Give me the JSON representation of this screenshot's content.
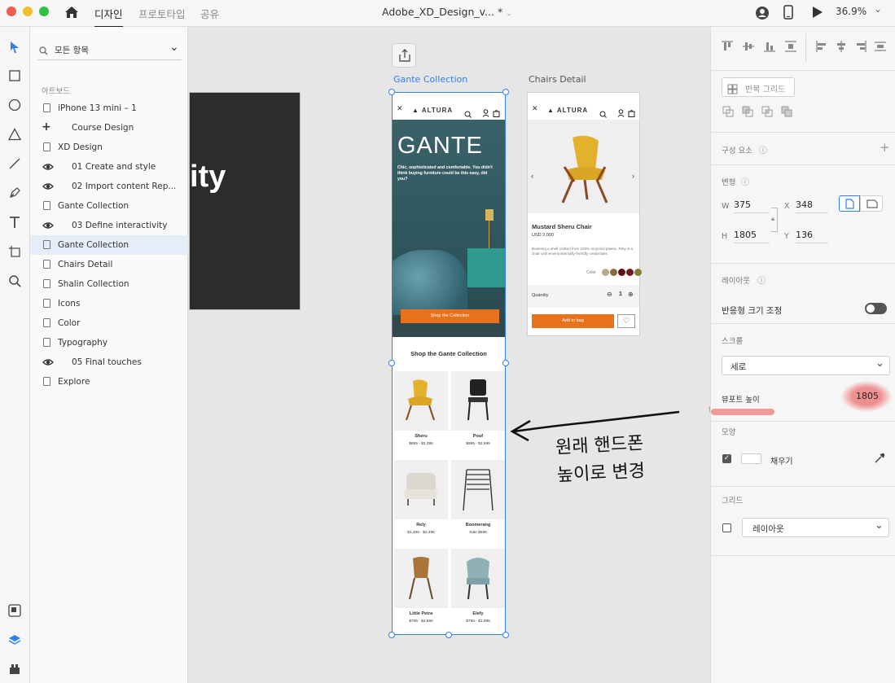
{
  "window": {
    "title": "Adobe_XD_Design_v...",
    "modified_marker": "*",
    "zoom": "36.9%",
    "tabs": [
      "디자인",
      "프로토타입",
      "공유"
    ]
  },
  "layers": {
    "search_placeholder": "모든 항목",
    "section_title": "아트보드",
    "items": [
      {
        "label": "iPhone 13 mini – 1",
        "icon": "doc-icon"
      },
      {
        "label": "Course Design",
        "icon": "plus-icon"
      },
      {
        "label": "XD Design",
        "icon": "doc-icon"
      },
      {
        "label": "01 Create and style",
        "icon": "eye-icon"
      },
      {
        "label": "02 Import content Rep...",
        "icon": "eye-icon"
      },
      {
        "label": "Gante Collection",
        "icon": "doc-icon"
      },
      {
        "label": "03 Define interactivity",
        "icon": "eye-icon"
      },
      {
        "label": "Gante Collection",
        "icon": "doc-icon",
        "selected": true
      },
      {
        "label": "Chairs Detail",
        "icon": "doc-icon"
      },
      {
        "label": "Shalin Collection",
        "icon": "doc-icon"
      },
      {
        "label": "Icons",
        "icon": "doc-icon"
      },
      {
        "label": "Color",
        "icon": "doc-icon"
      },
      {
        "label": "Typography",
        "icon": "doc-icon"
      },
      {
        "label": "05 Final touches",
        "icon": "eye-icon"
      },
      {
        "label": "Explore",
        "icon": "doc-icon"
      }
    ]
  },
  "canvas": {
    "dark_board_text": "ity",
    "gante_label": "Gante Collection",
    "detail_label": "Chairs Detail",
    "brand": "ALTURA",
    "hero_title": "GANTE",
    "hero_text": "Chic, sophisticated and comfortable. You didn't think buying furniture could be this easy, did you?",
    "hero_button": "Shop the Collection",
    "collection_title": "Shop the Gante Collection",
    "products": [
      {
        "name": "Sheru",
        "price": "$895 - $2,395"
      },
      {
        "name": "Pouf",
        "price": "$995 - $2,595"
      },
      {
        "name": "Rely",
        "price": "$1,495 - $2,495"
      },
      {
        "name": "Boomerang",
        "price": "Sale $595"
      },
      {
        "name": "Little Petra",
        "price": "$795 - $2,695"
      },
      {
        "name": "Elefy",
        "price": "$795 - $1,995"
      }
    ],
    "detail": {
      "product_name": "Mustard Sheru Chair",
      "price": "USD 2,000",
      "description": "Boasting a shell crafted from 100% recycled plastic, Rely is a chair with environmentally-friendly credentials.",
      "color_label": "Color",
      "quantity_label": "Quantity",
      "quantity_value": "1",
      "add_button": "Add to bag",
      "swatches": [
        "#b8a98c",
        "#8a6a3a",
        "#5a0f12",
        "#6b1a1f",
        "#8a7a30"
      ]
    },
    "annotation": "원래 핸드폰\n높이로 변경"
  },
  "props": {
    "repeat_grid": "반복 그리드",
    "components": "구성 요소",
    "transform": "변형",
    "w_label": "W",
    "w_value": "375",
    "x_label": "X",
    "x_value": "348",
    "h_label": "H",
    "h_value": "1805",
    "y_label": "Y",
    "y_value": "136",
    "layout": "레이아웃",
    "responsive": "반응형 크기 조정",
    "scroll": "스크롤",
    "scroll_value": "세로",
    "viewport_label": "뷰포트 높이",
    "viewport_value": "1805",
    "appearance": "모양",
    "fill": "채우기",
    "grid": "그리드",
    "grid_value": "레이아웃"
  },
  "colors": {
    "accent": "#2f80ed",
    "orange": "#e8711b",
    "hero": "#355b62"
  }
}
